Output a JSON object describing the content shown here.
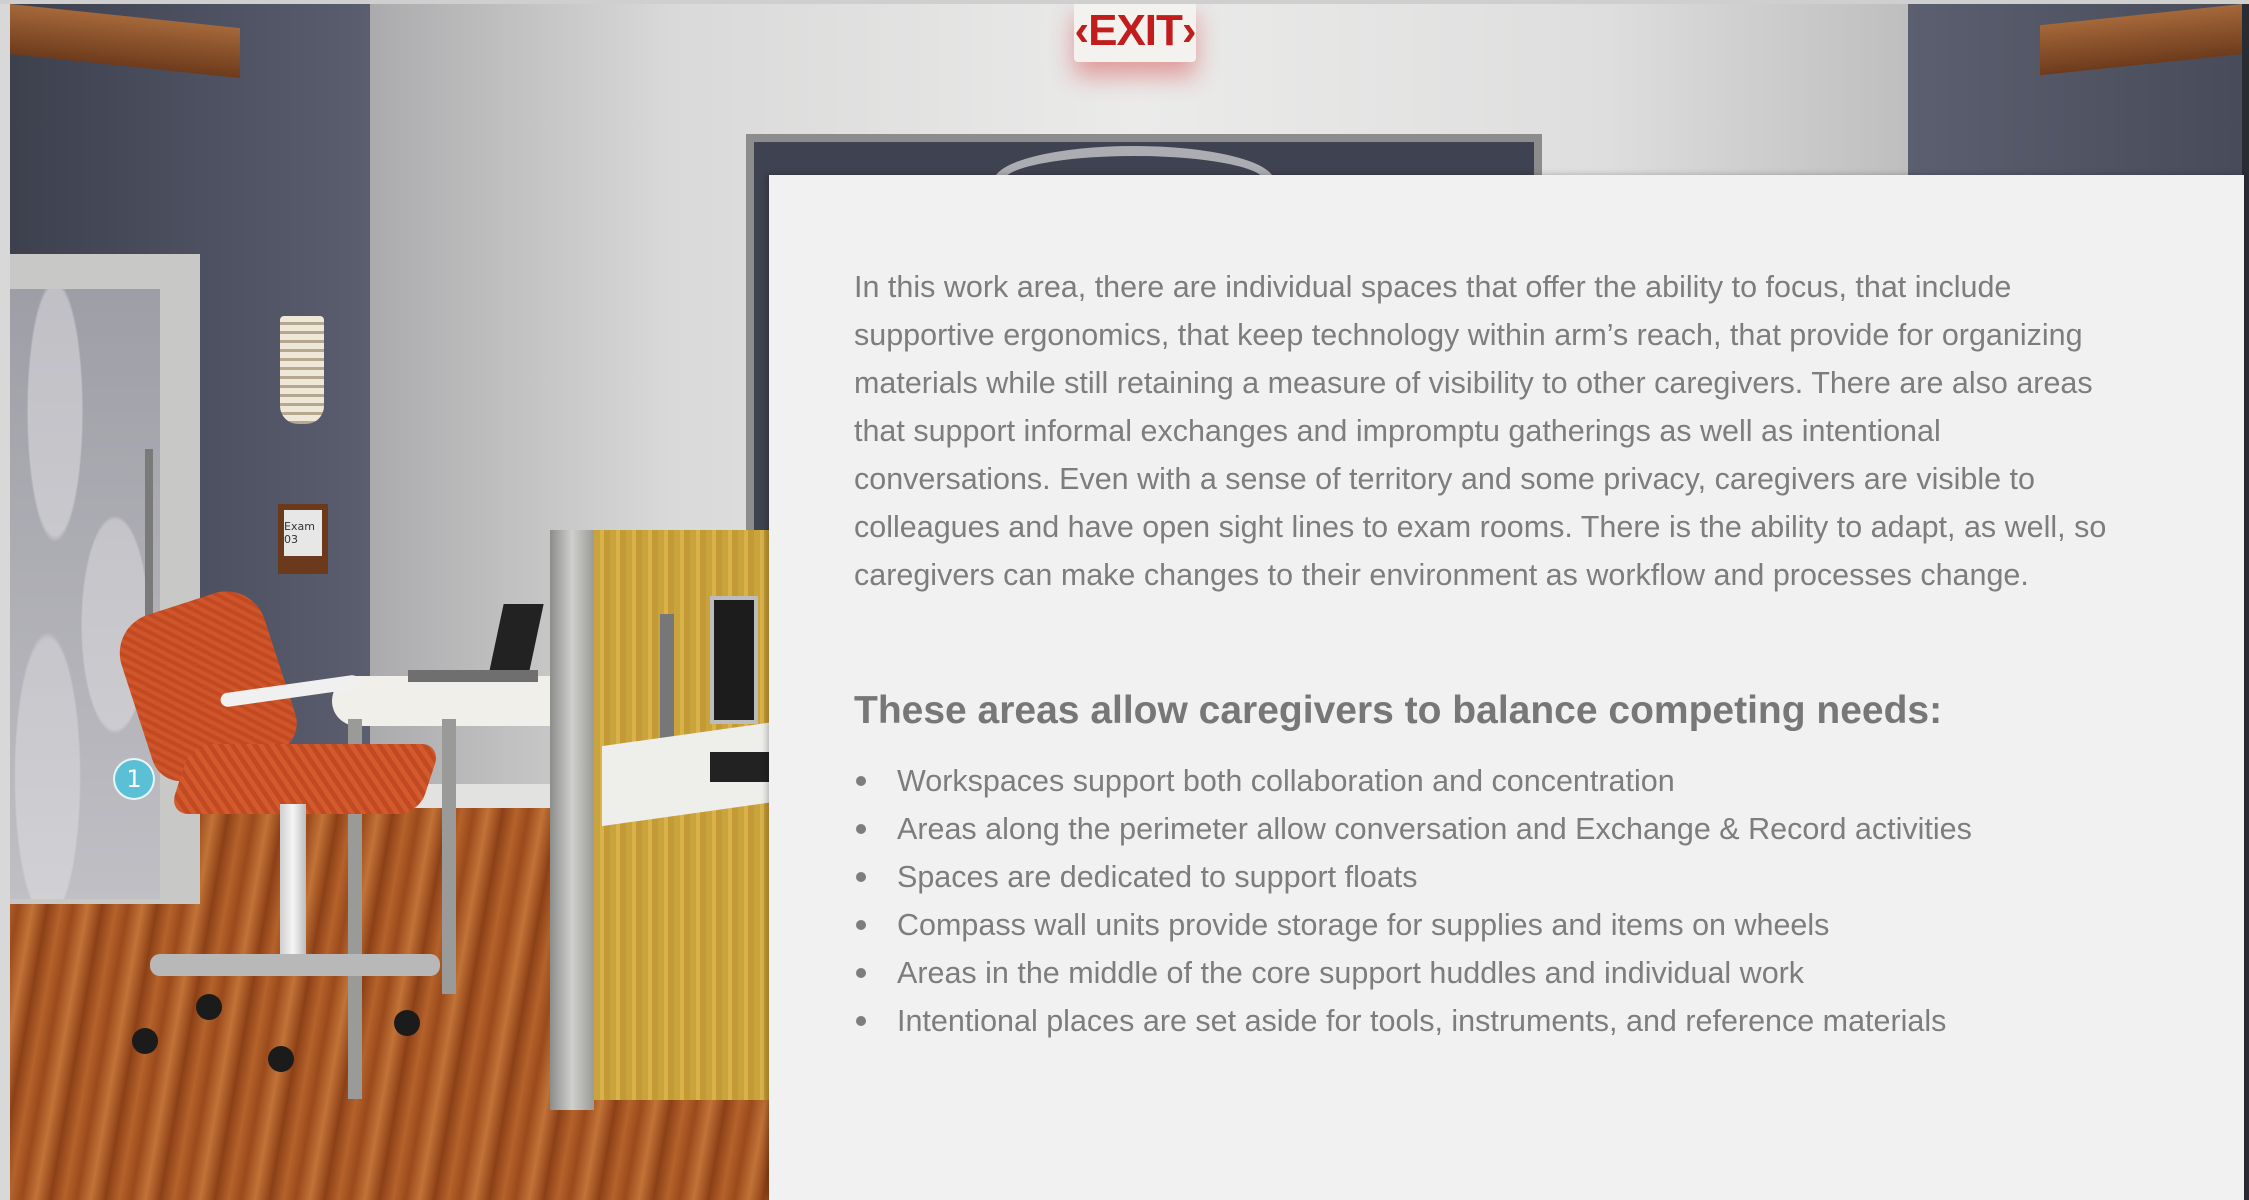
{
  "scene": {
    "exit_sign": "‹EXIT›",
    "exam_sign": "Exam 03",
    "hotspot_label": "1"
  },
  "panel": {
    "intro": "In this work area, there are individual spaces that offer the ability to focus, that include supportive ergonomics, that keep technology within arm’s reach, that provide for organizing materials while still retaining a measure of visibility to other caregivers. There are also areas that support informal exchanges and impromptu gatherings as well as intentional conversations. Even with a sense of territory and some privacy, caregivers are visible to colleagues and have open sight lines to exam rooms. There is the ability to adapt, as well, so caregivers can make changes to their environment as workflow and processes change.",
    "heading": "These areas allow caregivers to balance competing needs:",
    "items": [
      "Workspaces support both collaboration and concentration",
      "Areas along the perimeter allow conversation and Exchange & Record activities",
      "Spaces are dedicated to support floats",
      "Compass wall units provide storage for supplies and items on wheels",
      "Areas in the middle of the core support huddles and individual work",
      "Intentional places are set aside for tools, instruments, and reference materials"
    ]
  },
  "colors": {
    "panel_background": "#f1f1f1",
    "body_text": "#7d7d7d",
    "hotspot": "#5bc0d6",
    "exit_red": "#c11d1d"
  }
}
